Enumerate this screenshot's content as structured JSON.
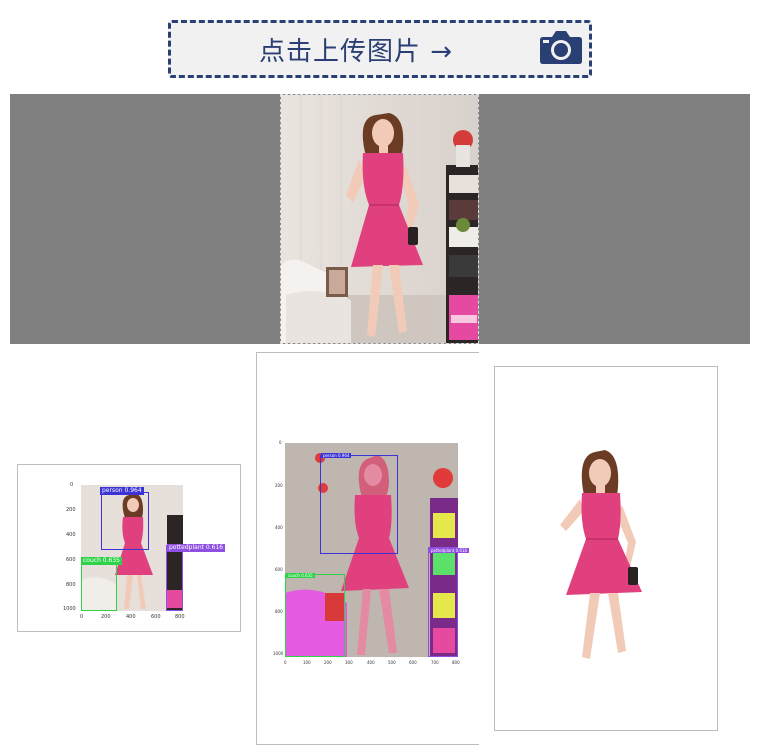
{
  "upload": {
    "label": "点击上传图片 →",
    "icon": "camera-icon"
  },
  "colors": {
    "accent": "#2a3f73",
    "preview_bg": "#808080",
    "dress": "#e0407e",
    "person_box": "#3b33d6",
    "couch_box": "#2fd34a",
    "plant_box": "#8f4fe0"
  },
  "detection": {
    "y_ticks": [
      "0",
      "200",
      "400",
      "600",
      "800",
      "1000"
    ],
    "x_ticks": [
      "0",
      "200",
      "400",
      "600",
      "800"
    ],
    "boxes": {
      "person": "person 0.964",
      "couch": "couch 0.635",
      "plant": "pottedplant 0.616"
    }
  },
  "segmentation": {
    "y_ticks": [
      "0",
      "200",
      "400",
      "600",
      "800",
      "1000"
    ],
    "x_ticks": [
      "0",
      "100",
      "200",
      "300",
      "400",
      "500",
      "600",
      "700",
      "800"
    ],
    "boxes": {
      "person": "person 0.964",
      "couch": "couch 0.635",
      "plant": "pottedplant 0.616"
    }
  }
}
